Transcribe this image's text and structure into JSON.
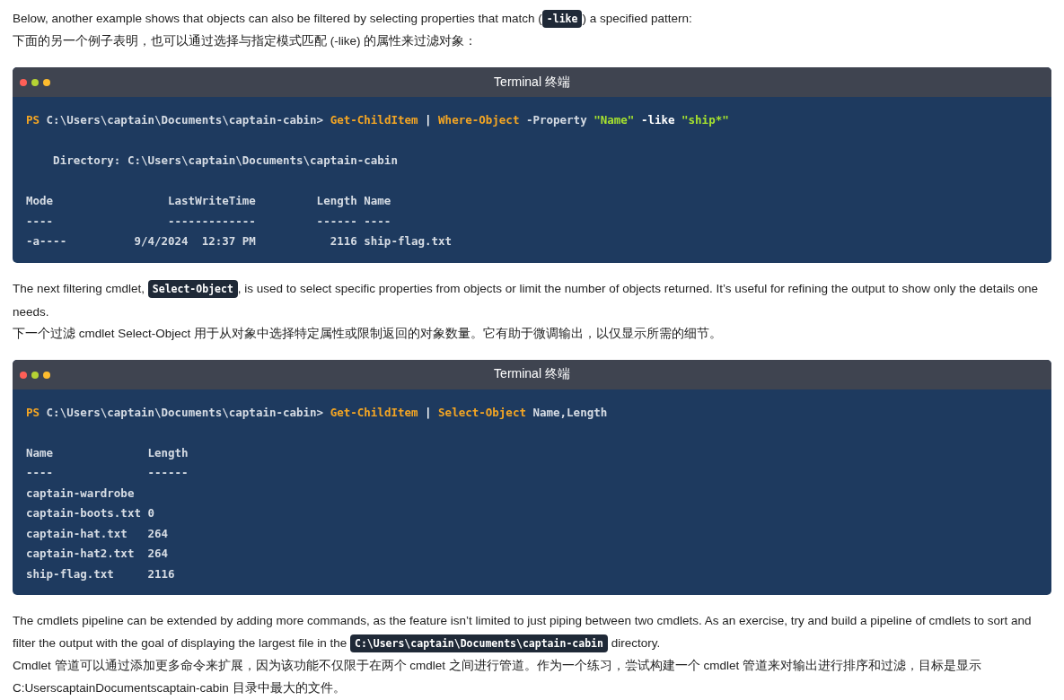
{
  "blocks": [
    {
      "kind": "para",
      "segments": [
        {
          "kind": "text",
          "text": "Below, another example shows that objects can also be filtered by selecting properties that match ("
        },
        {
          "kind": "code",
          "text": "-like"
        },
        {
          "kind": "text",
          "text": ") a specified pattern:"
        }
      ]
    },
    {
      "kind": "para",
      "segments": [
        {
          "kind": "text",
          "text": "下面的另一个例子表明，也可以通过选择与指定模式匹配 (-like) 的属性来过滤对象："
        }
      ]
    },
    {
      "kind": "terminal",
      "title": "Terminal  终端",
      "lines": [
        {
          "kind": "code",
          "tokens": [
            {
              "kind": "prompt",
              "text": "PS"
            },
            {
              "kind": "plain",
              "text": " C:\\Users\\captain\\Documents\\captain-cabin> "
            },
            {
              "kind": "cmd",
              "text": "Get-ChildItem"
            },
            {
              "kind": "op",
              "text": " | "
            },
            {
              "kind": "cmd",
              "text": "Where-Object"
            },
            {
              "kind": "plain",
              "text": " -Property "
            },
            {
              "kind": "string",
              "text": "\"Name\""
            },
            {
              "kind": "op",
              "text": " -like "
            },
            {
              "kind": "string",
              "text": "\"ship*\""
            }
          ]
        },
        {
          "kind": "blank"
        },
        {
          "kind": "code",
          "tokens": [
            {
              "kind": "plain",
              "text": "    Directory: C:\\Users\\captain\\Documents\\captain-cabin"
            }
          ]
        },
        {
          "kind": "blank"
        },
        {
          "kind": "code",
          "tokens": [
            {
              "kind": "plain",
              "text": "Mode                 LastWriteTime         Length Name"
            }
          ]
        },
        {
          "kind": "code",
          "tokens": [
            {
              "kind": "plain",
              "text": "----                 -------------         ------ ----"
            }
          ]
        },
        {
          "kind": "code",
          "tokens": [
            {
              "kind": "plain",
              "text": "-a----          9/4/2024  12:37 PM           2116 ship-flag.txt"
            }
          ]
        }
      ]
    },
    {
      "kind": "para",
      "segments": [
        {
          "kind": "text",
          "text": "The next filtering cmdlet, "
        },
        {
          "kind": "code",
          "text": "Select-Object"
        },
        {
          "kind": "text",
          "text": ", is used to select specific properties from objects or limit the number of objects returned. It’s useful for refining the output to show only the details one needs."
        }
      ]
    },
    {
      "kind": "para",
      "segments": [
        {
          "kind": "text",
          "text": "下一个过滤 cmdlet Select-Object 用于从对象中选择特定属性或限制返回的对象数量。它有助于微调输出，以仅显示所需的细节。"
        }
      ]
    },
    {
      "kind": "terminal",
      "title": "Terminal  终端",
      "lines": [
        {
          "kind": "code",
          "tokens": [
            {
              "kind": "prompt",
              "text": "PS"
            },
            {
              "kind": "plain",
              "text": " C:\\Users\\captain\\Documents\\captain-cabin> "
            },
            {
              "kind": "cmd",
              "text": "Get-ChildItem"
            },
            {
              "kind": "op",
              "text": " | "
            },
            {
              "kind": "cmd",
              "text": "Select-Object"
            },
            {
              "kind": "plain",
              "text": " Name,Length"
            }
          ]
        },
        {
          "kind": "blank"
        },
        {
          "kind": "code",
          "tokens": [
            {
              "kind": "plain",
              "text": "Name              Length"
            }
          ]
        },
        {
          "kind": "code",
          "tokens": [
            {
              "kind": "plain",
              "text": "----              ------"
            }
          ]
        },
        {
          "kind": "code",
          "tokens": [
            {
              "kind": "plain",
              "text": "captain-wardrobe"
            }
          ]
        },
        {
          "kind": "code",
          "tokens": [
            {
              "kind": "plain",
              "text": "captain-boots.txt 0"
            }
          ]
        },
        {
          "kind": "code",
          "tokens": [
            {
              "kind": "plain",
              "text": "captain-hat.txt   264"
            }
          ]
        },
        {
          "kind": "code",
          "tokens": [
            {
              "kind": "plain",
              "text": "captain-hat2.txt  264"
            }
          ]
        },
        {
          "kind": "code",
          "tokens": [
            {
              "kind": "plain",
              "text": "ship-flag.txt     2116"
            }
          ]
        }
      ]
    },
    {
      "kind": "para",
      "segments": [
        {
          "kind": "text",
          "text": "The cmdlets pipeline can be extended by adding more commands, as the feature isn’t limited to just piping between two cmdlets. As an exercise, try and build a pipeline of cmdlets to sort and filter the output with the goal of displaying the largest file in the "
        },
        {
          "kind": "code",
          "text": "C:\\Users\\captain\\Documents\\captain-cabin"
        },
        {
          "kind": "text",
          "text": " directory."
        }
      ]
    },
    {
      "kind": "para",
      "segments": [
        {
          "kind": "text",
          "text": "Cmdlet 管道可以通过添加更多命令来扩展，因为该功能不仅限于在两个 cmdlet 之间进行管道。作为一个练习，尝试构建一个 cmdlet 管道来对输出进行排序和过滤，目标是显示 C:UserscaptainDocumentscaptain-cabin 目录中最大的文件。"
        }
      ]
    }
  ]
}
